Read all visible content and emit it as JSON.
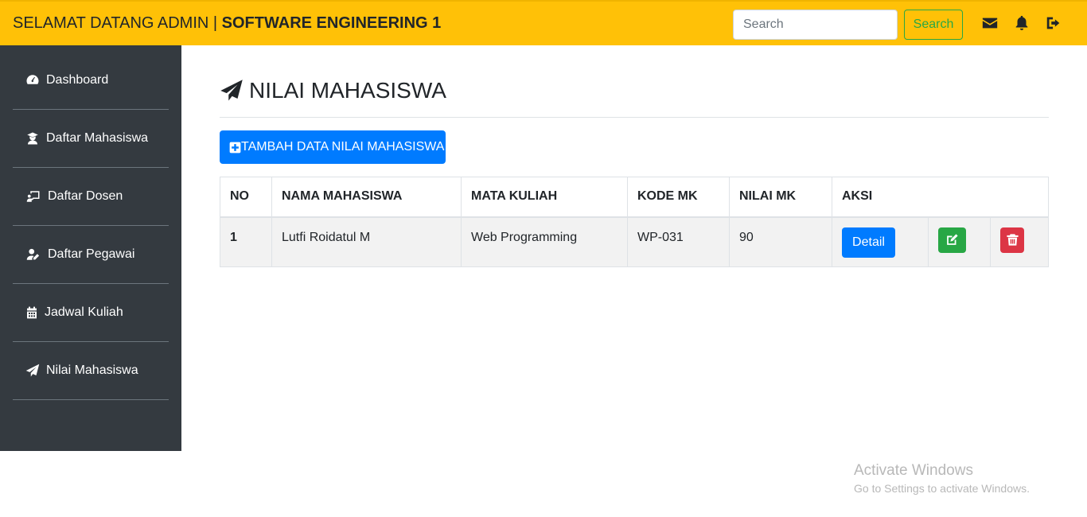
{
  "navbar": {
    "brand_prefix": "SELAMAT DATANG ADMIN | ",
    "brand_name": "SOFTWARE ENGINEERING 1",
    "search_placeholder": "Search",
    "search_button": "Search",
    "icons": [
      "envelope-icon",
      "bell-icon",
      "sign-out-icon"
    ]
  },
  "sidebar": {
    "items": [
      {
        "label": "Dashboard",
        "icon": "tachometer-icon"
      },
      {
        "label": "Daftar Mahasiswa",
        "icon": "user-graduate-icon"
      },
      {
        "label": "Daftar Dosen",
        "icon": "chalkboard-teacher-icon"
      },
      {
        "label": "Daftar Pegawai",
        "icon": "user-edit-icon"
      },
      {
        "label": "Jadwal Kuliah",
        "icon": "calendar-icon"
      },
      {
        "label": "Nilai Mahasiswa",
        "icon": "paper-plane-icon"
      }
    ]
  },
  "main": {
    "title": "NILAI MAHASISWA",
    "title_icon": "paper-plane-icon",
    "add_button": "TAMBAH DATA NILAI MAHASISWA",
    "table": {
      "headers": [
        "NO",
        "NAMA MAHASISWA",
        "MATA KULIAH",
        "KODE MK",
        "NILAI MK",
        "AKSI"
      ],
      "rows": [
        {
          "no": "1",
          "nama": "Lutfi Roidatul M",
          "matkul": "Web Programming",
          "kode": "WP-031",
          "nilai": "90",
          "detail": "Detail"
        }
      ]
    }
  },
  "watermark": {
    "line1": "Activate Windows",
    "line2": "Go to Settings to activate Windows."
  },
  "colors": {
    "navbar": "#ffc107",
    "sidebar": "#343a40",
    "primary": "#007bff",
    "success": "#28a745",
    "danger": "#dc3545"
  }
}
